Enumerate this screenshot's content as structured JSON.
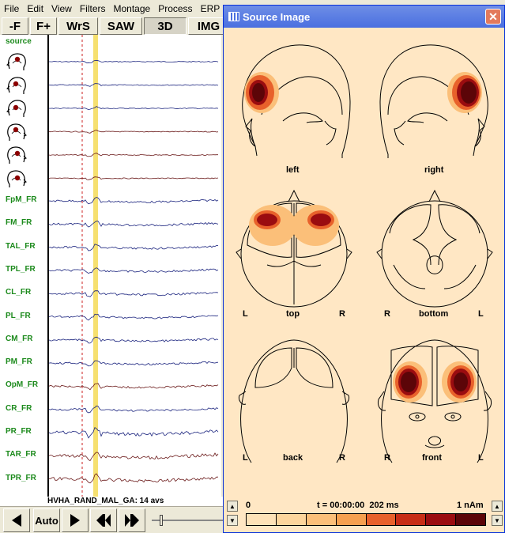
{
  "menu": [
    "File",
    "Edit",
    "View",
    "Filters",
    "Montage",
    "Process",
    "ERP",
    "A"
  ],
  "toolbar": [
    "-F",
    "F+",
    "WrS",
    "SAW",
    "3D",
    "IMG"
  ],
  "source_label": "source",
  "channels": [
    "FpM_FR",
    "FM_FR",
    "TAL_FR",
    "TPL_FR",
    "CL_FR",
    "PL_FR",
    "CM_FR",
    "PM_FR",
    "OpM_FR",
    "CR_FR",
    "PR_FR",
    "TAR_FR",
    "TPR_FR"
  ],
  "status_text": "HVHA_RAND_MAL_GA: 14 avs",
  "auto_label": "Auto",
  "window": {
    "title": "Source Image",
    "close": "✕",
    "views": {
      "left": "left",
      "right": "right",
      "top": "top",
      "bottom": "bottom",
      "back": "back",
      "front": "front"
    },
    "side_L": "L",
    "side_R": "R",
    "scale_min": "0",
    "scale_time": "t = 00:00:00  202 ms",
    "scale_max": "1 nAm",
    "scale_colors": [
      "#fde2b8",
      "#fcd59c",
      "#fbbf79",
      "#f6a04f",
      "#e8612b",
      "#c72d16",
      "#9a0c10",
      "#5c0508"
    ]
  },
  "colors": {
    "channel_label": "#1c8a1c",
    "cursor_band": "#f6e070",
    "trace": "#1a237e",
    "trace_red": "#6b1a1a"
  }
}
